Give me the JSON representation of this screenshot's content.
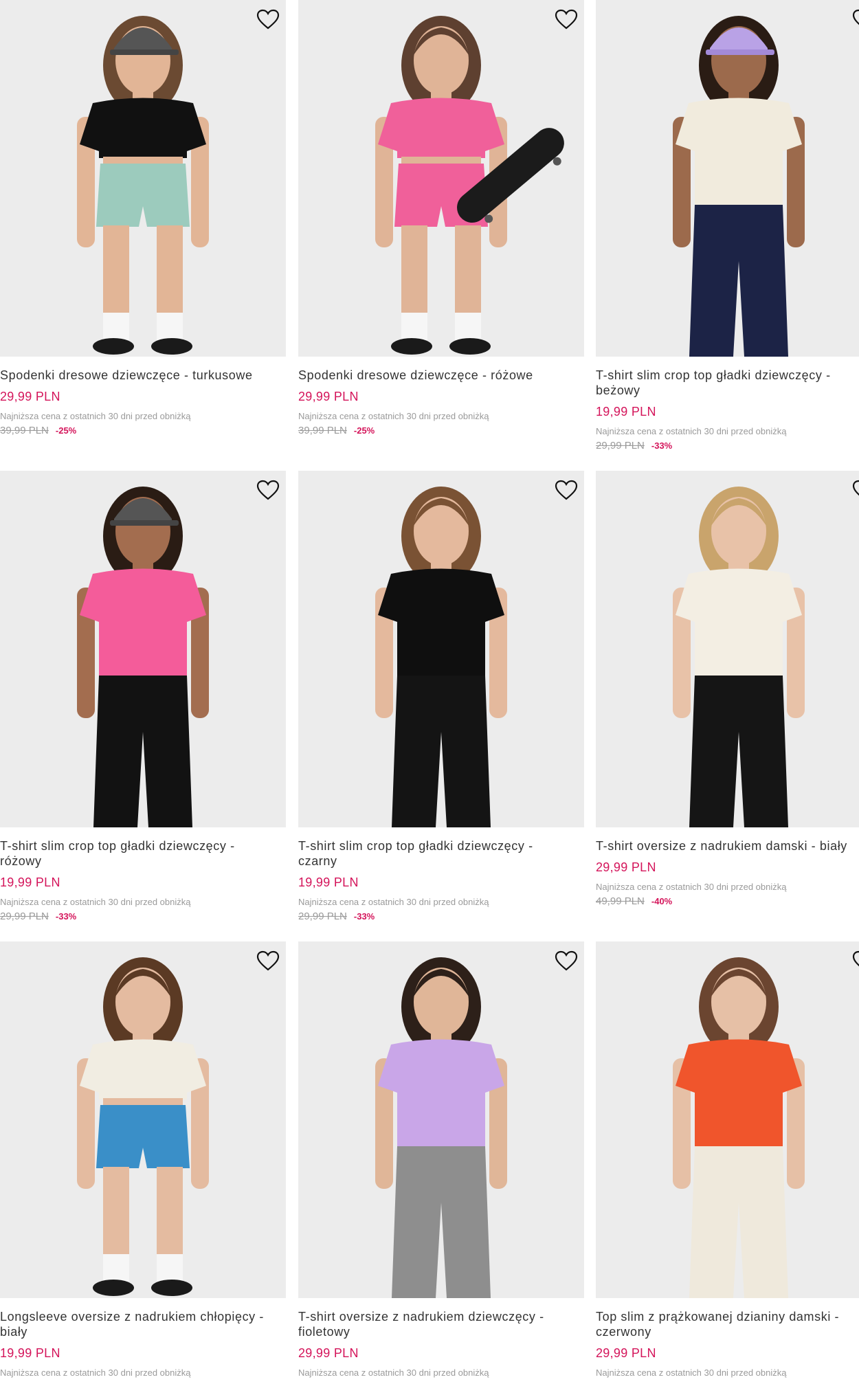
{
  "colors": {
    "price": "#d4145a",
    "muted": "#9a9a9a",
    "image_bg": "#ececec"
  },
  "products": [
    {
      "title": "Spodenki dresowe dziewczęce - turkusowe",
      "price": "29,99 PLN",
      "lowest_label": "Najniższa cena z ostatnich 30 dni przed obniżką",
      "old_price": "39,99 PLN",
      "discount": "-25%",
      "top": "#111111",
      "bottom": "#9ccbbd",
      "skin": "#e2b596",
      "hair": "#6b4a32",
      "accessory": "cap-grey",
      "bottom_type": "shorts"
    },
    {
      "title": "Spodenki dresowe dziewczęce - różowe",
      "price": "29,99 PLN",
      "lowest_label": "Najniższa cena z ostatnich 30 dni przed obniżką",
      "old_price": "39,99 PLN",
      "discount": "-25%",
      "top": "#f0609a",
      "bottom": "#f0609a",
      "skin": "#e0b497",
      "hair": "#5e4030",
      "accessory": "skateboard",
      "bottom_type": "shorts"
    },
    {
      "title": "T-shirt slim crop top gładki dziewczęcy - beżowy",
      "price": "19,99 PLN",
      "lowest_label": "Najniższa cena z ostatnich 30 dni przed obniżką",
      "old_price": "29,99 PLN",
      "discount": "-33%",
      "top": "#f1ebdd",
      "bottom": "#1c2346",
      "skin": "#9c6a4c",
      "hair": "#2a1c14",
      "accessory": "cap-purple",
      "bottom_type": "pants"
    },
    {
      "title": "T-shirt slim crop top gładki dziewczęcy - różowy",
      "price": "19,99 PLN",
      "lowest_label": "Najniższa cena z ostatnich 30 dni przed obniżką",
      "old_price": "29,99 PLN",
      "discount": "-33%",
      "top": "#f45c9a",
      "bottom": "#121212",
      "skin": "#a36d4f",
      "hair": "#2a1c14",
      "accessory": "cap-grey",
      "bottom_type": "pants"
    },
    {
      "title": "T-shirt slim crop top gładki dziewczęcy - czarny",
      "price": "19,99 PLN",
      "lowest_label": "Najniższa cena z ostatnich 30 dni przed obniżką",
      "old_price": "29,99 PLN",
      "discount": "-33%",
      "top": "#0f0f0f",
      "bottom": "#141414",
      "skin": "#e4b99d",
      "hair": "#7a5234",
      "accessory": "none",
      "bottom_type": "pants"
    },
    {
      "title": "T-shirt oversize z nadrukiem damski - biały",
      "price": "29,99 PLN",
      "lowest_label": "Najniższa cena z ostatnich 30 dni przed obniżką",
      "old_price": "49,99 PLN",
      "discount": "-40%",
      "top": "#f3eee3",
      "bottom": "#151515",
      "skin": "#e8c2a8",
      "hair": "#c9a46c",
      "accessory": "none",
      "bottom_type": "pants"
    },
    {
      "title": "Longsleeve oversize z nadrukiem chłopięcy - biały",
      "price": "19,99 PLN",
      "lowest_label": "Najniższa cena z ostatnich 30 dni przed obniżką",
      "top": "#f1ede2",
      "bottom": "#3a8fc8",
      "skin": "#e4bba0",
      "hair": "#5b3a24",
      "accessory": "none",
      "bottom_type": "shorts"
    },
    {
      "title": "T-shirt oversize z nadrukiem dziewczęcy - fioletowy",
      "price": "29,99 PLN",
      "lowest_label": "Najniższa cena z ostatnich 30 dni przed obniżką",
      "top": "#c9a6e8",
      "bottom": "#8e8e8e",
      "skin": "#e0b698",
      "hair": "#2d2019",
      "accessory": "none",
      "bottom_type": "pants"
    },
    {
      "title": "Top slim z prążkowanej dzianiny damski - czerwony",
      "price": "29,99 PLN",
      "lowest_label": "Najniższa cena z ostatnich 30 dni przed obniżką",
      "top": "#f0552c",
      "bottom": "#efe9dc",
      "skin": "#e6c0a6",
      "hair": "#6b4530",
      "accessory": "none",
      "bottom_type": "pants"
    }
  ]
}
